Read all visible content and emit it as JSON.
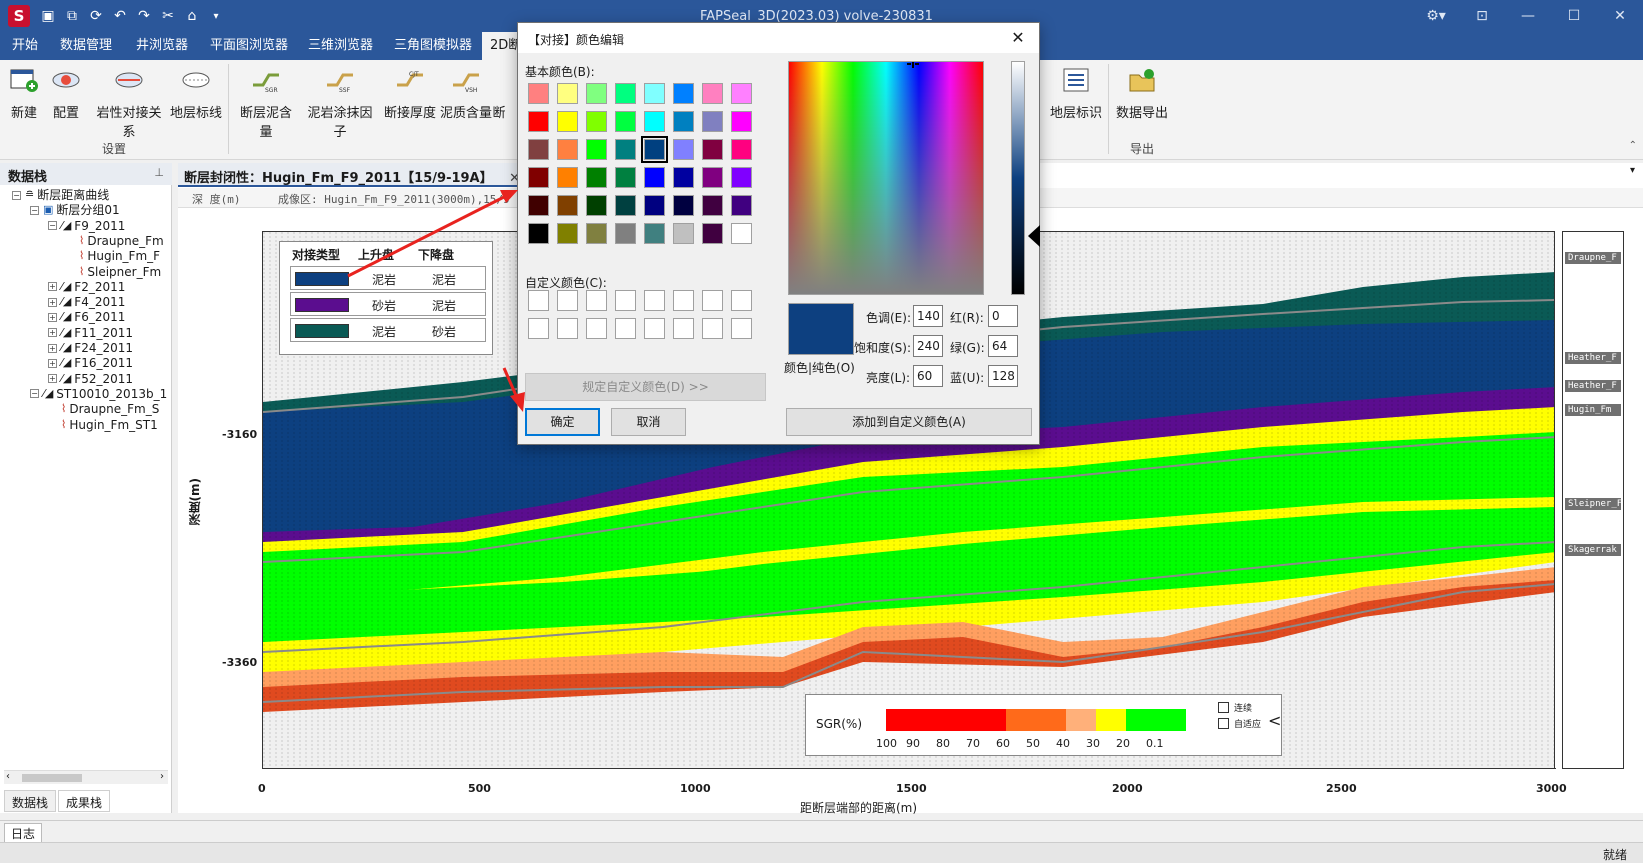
{
  "window": {
    "title": "FAPSeal_3D(2023.03) volve-230831",
    "logo": "S"
  },
  "menu": {
    "tabs": [
      "开始",
      "数据管理",
      "井浏览器",
      "平面图浏览器",
      "三维浏览器",
      "三角图模拟器",
      "2D断"
    ]
  },
  "ribbon": {
    "buttons": [
      "新建",
      "配置",
      "岩性对接关系",
      "地层标线",
      "断层泥含量",
      "泥岩涂抹因子",
      "断接厚度",
      "泥质含量",
      "断"
    ],
    "right_buttons": [
      "地层标识",
      "数据导出"
    ],
    "groups": [
      "设置",
      "导出"
    ],
    "icon_tags": [
      "SGR",
      "SSF",
      "CJT",
      "VSH"
    ]
  },
  "left_panel": {
    "title": "数据栈",
    "pin": "ꟷ",
    "tree": [
      {
        "label": "断层距离曲线",
        "level": 0,
        "icon": "folder-icon"
      },
      {
        "label": "断层分组01",
        "level": 1,
        "icon": "group-icon"
      },
      {
        "label": "F9_2011",
        "level": 2,
        "icon": "fault-icon"
      },
      {
        "label": "Draupne_Fm",
        "level": 3,
        "icon": "curve-icon"
      },
      {
        "label": "Hugin_Fm_F",
        "level": 3,
        "icon": "curve-icon"
      },
      {
        "label": "Sleipner_Fm",
        "level": 3,
        "icon": "curve-icon"
      },
      {
        "label": "F2_2011",
        "level": 2,
        "icon": "fault-icon"
      },
      {
        "label": "F4_2011",
        "level": 2,
        "icon": "fault-icon"
      },
      {
        "label": "F6_2011",
        "level": 2,
        "icon": "fault-icon"
      },
      {
        "label": "F11_2011",
        "level": 2,
        "icon": "fault-icon"
      },
      {
        "label": "F24_2011",
        "level": 2,
        "icon": "fault-icon"
      },
      {
        "label": "F16_2011",
        "level": 2,
        "icon": "fault-icon"
      },
      {
        "label": "F52_2011",
        "level": 2,
        "icon": "fault-icon"
      },
      {
        "label": "ST10010_2013b_1",
        "level": 1,
        "icon": "fault-icon"
      },
      {
        "label": "Draupne_Fm_S",
        "level": 2,
        "icon": "curve-icon"
      },
      {
        "label": "Hugin_Fm_ST1",
        "level": 2,
        "icon": "curve-icon"
      }
    ],
    "bottom_tabs": [
      "数据栈",
      "成果栈"
    ]
  },
  "document": {
    "tab_title": "断层封闭性：Hugin_Fm_F9_2011【15/9-19A】",
    "ruler_left": "深 度(m)",
    "ruler_right": "成像区: Hugin_Fm_F9_2011(3000m),15/9",
    "y_label": "深度(m)",
    "y_ticks": [
      "-3160",
      "-3160",
      "-3360"
    ],
    "x_label": "距断层端部的距离(m)",
    "x_ticks": [
      "0",
      "500",
      "1000",
      "1500",
      "2000",
      "2500",
      "3000"
    ],
    "right_labels": [
      "Draupne_F",
      "Heather_F",
      "Heather_F",
      "Hugin_Fm",
      "Sleipner_F",
      "Skagerrak"
    ]
  },
  "legend": {
    "headers": [
      "对接类型",
      "上升盘",
      "下降盘"
    ],
    "rows": [
      {
        "color": "#0d4080",
        "up": "泥岩",
        "down": "泥岩"
      },
      {
        "color": "#5b0d8f",
        "up": "砂岩",
        "down": "泥岩"
      },
      {
        "color": "#0a5a55",
        "up": "泥岩",
        "down": "砂岩"
      }
    ]
  },
  "sgr_bar": {
    "title": "SGR(%)",
    "ticks": [
      "100",
      "90",
      "80",
      "70",
      "60",
      "50",
      "40",
      "30",
      "20",
      "0.1"
    ],
    "colors": [
      "#ff0000",
      "#ff0000",
      "#ff0000",
      "#ff0000",
      "#ff6a1a",
      "#ff6a1a",
      "#ffb07a",
      "#ffff00",
      "#00ff00",
      "#00ff00"
    ],
    "checks": [
      "连续",
      "自适应"
    ],
    "toggle": "<"
  },
  "dialog": {
    "title": "【对接】颜色编辑",
    "close": "✕",
    "basic_label": "基本颜色(B):",
    "custom_label": "自定义颜色(C):",
    "define_btn": "规定自定义颜色(D) >>",
    "ok_btn": "确定",
    "cancel_btn": "取消",
    "add_btn": "添加到自定义颜色(A)",
    "color_solid": "颜色|纯色(O)",
    "fields": {
      "hue_label": "色调(E):",
      "hue": "140",
      "sat_label": "饱和度(S):",
      "sat": "240",
      "lum_label": "亮度(L):",
      "lum": "60",
      "red_label": "红(R):",
      "red": "0",
      "green_label": "绿(G):",
      "green": "64",
      "blue_label": "蓝(U):",
      "blue": "128"
    },
    "basic_colors": [
      "#ff8080",
      "#ffff80",
      "#80ff80",
      "#00ff80",
      "#80ffff",
      "#0080ff",
      "#ff80c0",
      "#ff80ff",
      "#ff0000",
      "#ffff00",
      "#80ff00",
      "#00ff40",
      "#00ffff",
      "#0080c0",
      "#8080c0",
      "#ff00ff",
      "#804040",
      "#ff8040",
      "#00ff00",
      "#008080",
      "#004080",
      "#8080ff",
      "#800040",
      "#ff0080",
      "#800000",
      "#ff8000",
      "#008000",
      "#008040",
      "#0000ff",
      "#0000a0",
      "#800080",
      "#8000ff",
      "#400000",
      "#804000",
      "#004000",
      "#004040",
      "#000080",
      "#000040",
      "#400040",
      "#400080",
      "#000000",
      "#808000",
      "#808040",
      "#808080",
      "#408080",
      "#c0c0c0",
      "#400040",
      "#ffffff"
    ],
    "selected_index": 20,
    "current_color": "#0d4080"
  },
  "status": {
    "log_tab": "日志",
    "ready": "就绪"
  }
}
